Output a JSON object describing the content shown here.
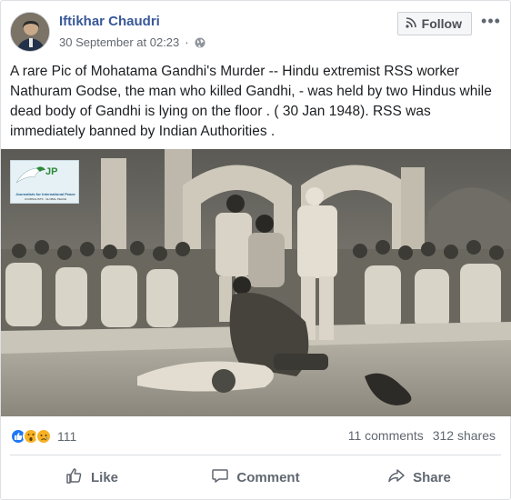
{
  "post": {
    "author": "Iftikhar Chaudri",
    "timestamp": "30 September at 02:23",
    "privacy_icon": "globe-icon",
    "follow_label": "Follow",
    "more_label": "•••",
    "caption": "A rare Pic of Mohatama Gandhi's Murder -- Hindu extremist RSS worker Nathuram Godse, the man who killed Gandhi, - was held by two Hindus while dead body of Gandhi is lying on the floor . ( 30 Jan 1948). RSS was immediately banned by Indian Authorities .",
    "photo": {
      "logo_text": "JP",
      "logo_subtitle": "Journalists for International Peace",
      "logo_subtitle2": "JOURNALISTS · GLOBAL PEACE"
    }
  },
  "engagement": {
    "reaction_icons": [
      "like-icon",
      "wow-icon",
      "sad-icon"
    ],
    "reaction_count": "111",
    "comments": "11 comments",
    "shares": "312 shares"
  },
  "actions": {
    "like": "Like",
    "comment": "Comment",
    "share": "Share"
  },
  "colors": {
    "link_blue": "#385898",
    "muted_grey": "#606770",
    "like_blue": "#2078f4",
    "emoji_yellow": "#f7b125"
  }
}
